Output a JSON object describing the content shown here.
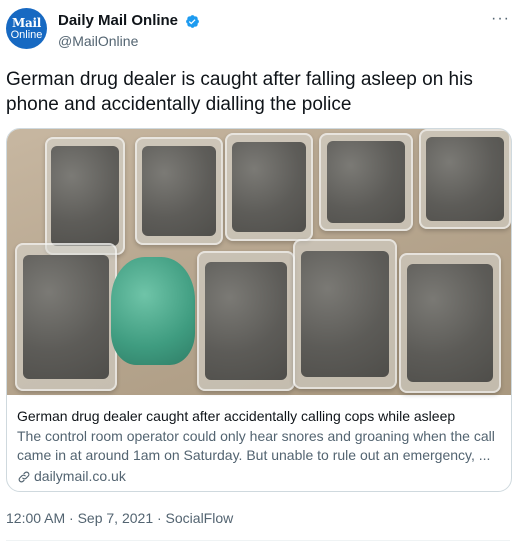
{
  "header": {
    "avatar_top": "Mail",
    "avatar_bottom": "Online",
    "display_name": "Daily Mail Online",
    "handle": "@MailOnline",
    "more": "···"
  },
  "tweet": {
    "text": "German drug dealer is caught after falling asleep on his phone and accidentally dialling the police"
  },
  "card": {
    "title": "German drug dealer caught after accidentally calling cops while asleep",
    "description": "The control room operator could only hear snores and groaning when the call came in at around 1am on Saturday. But unable to rule out an emergency, ...",
    "domain": "dailymail.co.uk"
  },
  "meta": {
    "timestamp": "12:00 AM · Sep 7, 2021 · SocialFlow"
  },
  "colors": {
    "accent": "#1d9bf0",
    "avatar": "#1769c2",
    "secondary_text": "#536471"
  }
}
